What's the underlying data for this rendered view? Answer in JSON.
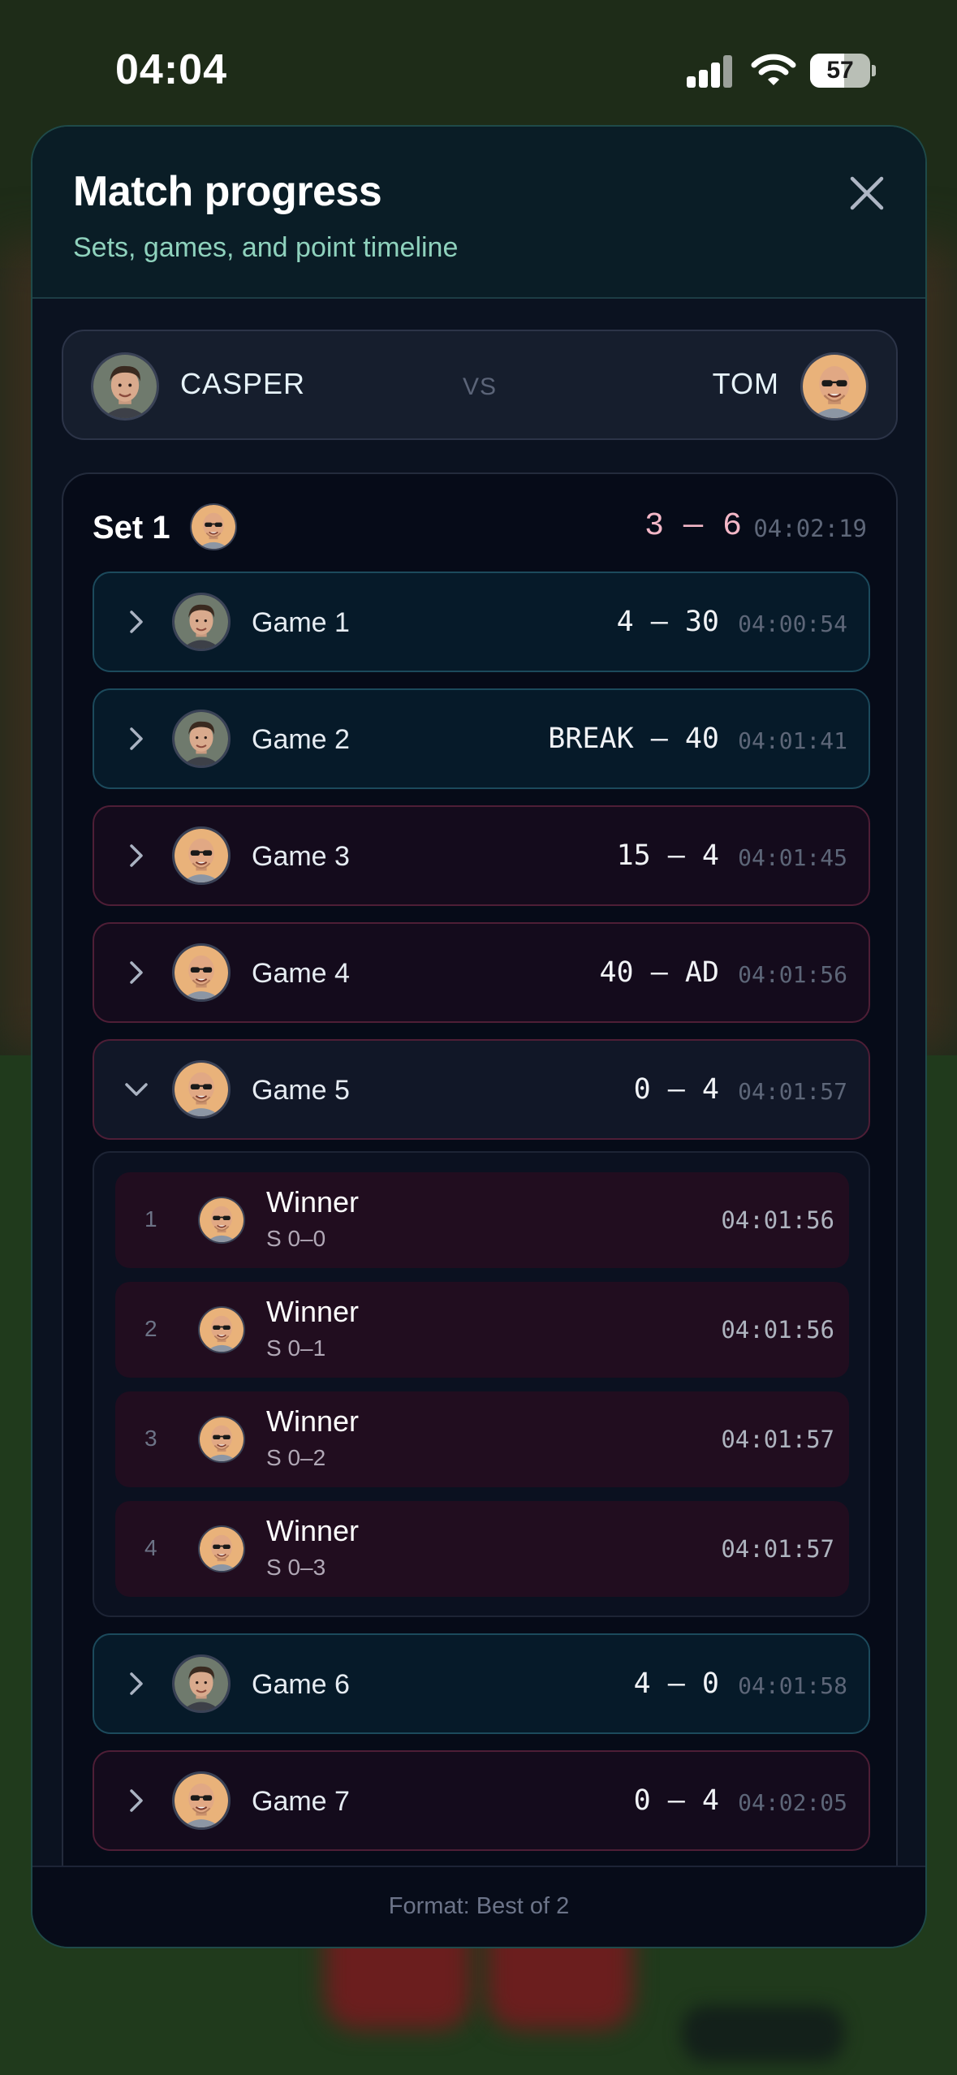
{
  "status_bar": {
    "time": "04:04",
    "battery": "57",
    "battery_level": 0.57
  },
  "modal": {
    "title": "Match progress",
    "subtitle": "Sets, games, and point timeline",
    "footer": "Format: Best of 2"
  },
  "players": {
    "left": "CASPER",
    "vs": "VS",
    "right": "TOM"
  },
  "set": {
    "title": "Set 1",
    "score": "3 — 6",
    "time": "04:02:19",
    "winner": "tom"
  },
  "games": [
    {
      "label": "Game 1",
      "score": "4 — 30",
      "time": "04:00:54",
      "player": "casper",
      "expanded": false
    },
    {
      "label": "Game 2",
      "score": "BREAK — 40",
      "time": "04:01:41",
      "player": "casper",
      "expanded": false
    },
    {
      "label": "Game 3",
      "score": "15 — 4",
      "time": "04:01:45",
      "player": "tom",
      "expanded": false
    },
    {
      "label": "Game 4",
      "score": "40 — AD",
      "time": "04:01:56",
      "player": "tom",
      "expanded": false
    },
    {
      "label": "Game 5",
      "score": "0 — 4",
      "time": "04:01:57",
      "player": "tom",
      "expanded": true
    },
    {
      "label": "Game 6",
      "score": "4 — 0",
      "time": "04:01:58",
      "player": "casper",
      "expanded": false
    },
    {
      "label": "Game 7",
      "score": "0 — 4",
      "time": "04:02:05",
      "player": "tom",
      "expanded": false
    }
  ],
  "points": [
    {
      "index": "1",
      "title": "Winner",
      "score": "S 0–0",
      "time": "04:01:56"
    },
    {
      "index": "2",
      "title": "Winner",
      "score": "S 0–1",
      "time": "04:01:56"
    },
    {
      "index": "3",
      "title": "Winner",
      "score": "S 0–2",
      "time": "04:01:57"
    },
    {
      "index": "4",
      "title": "Winner",
      "score": "S 0–3",
      "time": "04:01:57"
    }
  ],
  "colors": {
    "casper_row_border": "#1c4a5c",
    "tom_row_border": "#4e1e36",
    "point_row_bg": "#210d1f",
    "accent_subtitle": "#8fd2bd",
    "set_score": "#f3b7c7"
  },
  "icons": {
    "close": "close-icon",
    "collapsed": "chevron-right-icon",
    "expanded": "chevron-down-icon"
  }
}
